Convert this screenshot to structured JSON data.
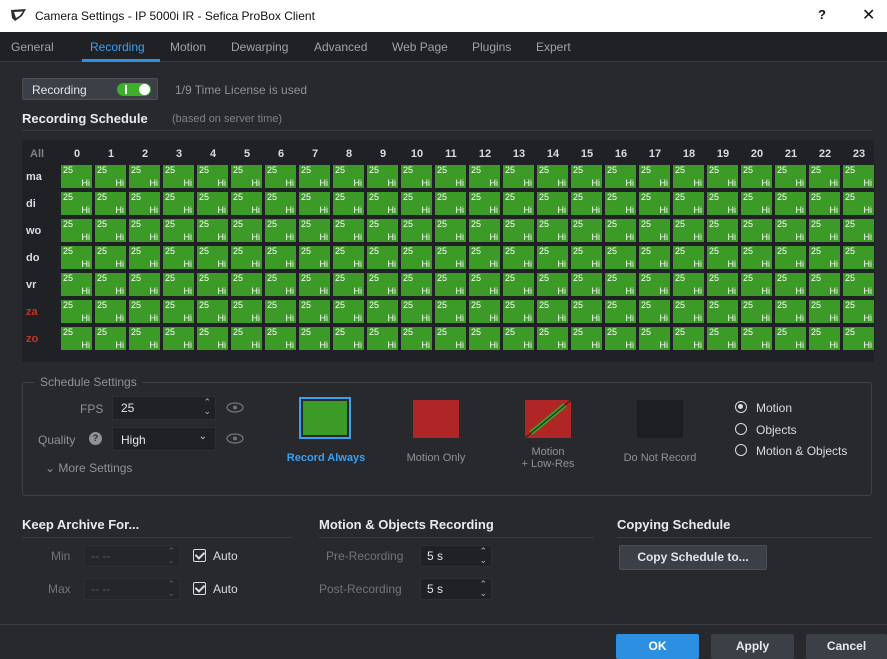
{
  "window": {
    "title": "Camera Settings - IP 5000i IR - Sefica ProBox Client",
    "help": "?",
    "close": "✕"
  },
  "tabs": [
    "General",
    "Recording",
    "Motion",
    "Dewarping",
    "Advanced",
    "Web Page",
    "Plugins",
    "Expert"
  ],
  "active_tab": "Recording",
  "recording": {
    "label": "Recording",
    "enabled": true,
    "license_text": "1/9 Time License is used"
  },
  "schedule": {
    "title": "Recording Schedule",
    "subtitle": "(based on server time)",
    "all_label": "All",
    "hours": [
      "0",
      "1",
      "2",
      "3",
      "4",
      "5",
      "6",
      "7",
      "8",
      "9",
      "10",
      "11",
      "12",
      "13",
      "14",
      "15",
      "16",
      "17",
      "18",
      "19",
      "20",
      "21",
      "22",
      "23"
    ],
    "days": [
      {
        "label": "ma",
        "weekend": false
      },
      {
        "label": "di",
        "weekend": false
      },
      {
        "label": "wo",
        "weekend": false
      },
      {
        "label": "do",
        "weekend": false
      },
      {
        "label": "vr",
        "weekend": false
      },
      {
        "label": "za",
        "weekend": true
      },
      {
        "label": "zo",
        "weekend": true
      }
    ],
    "cell_fps": "25",
    "cell_quality": "Hi",
    "cell_color": "#3c9a27"
  },
  "schedule_settings": {
    "legend": "Schedule Settings",
    "fps_label": "FPS",
    "fps_value": "25",
    "quality_label": "Quality",
    "quality_value": "High",
    "more_settings": "More Settings",
    "modes": [
      {
        "label": "Record Always",
        "color": "#3c9a27",
        "active": true
      },
      {
        "label": "Motion Only",
        "color": "#b02525",
        "active": false
      },
      {
        "label": "Motion\n+ Low-Res",
        "color": "#b02525",
        "active": false
      },
      {
        "label": "Do Not Record",
        "color": "#1c1e22",
        "active": false
      }
    ],
    "radio_options": [
      {
        "label": "Motion",
        "selected": true
      },
      {
        "label": "Objects",
        "selected": false
      },
      {
        "label": "Motion & Objects",
        "selected": false
      }
    ]
  },
  "keep_archive": {
    "title": "Keep Archive For...",
    "min_label": "Min",
    "min_value": "-- --",
    "max_label": "Max",
    "max_value": "-- --",
    "auto_label": "Auto"
  },
  "motion_recording": {
    "title": "Motion & Objects Recording",
    "pre_label": "Pre-Recording",
    "pre_value": "5 s",
    "post_label": "Post-Recording",
    "post_value": "5 s"
  },
  "copying": {
    "title": "Copying Schedule",
    "button": "Copy Schedule to..."
  },
  "footer": {
    "ok": "OK",
    "apply": "Apply",
    "cancel": "Cancel"
  }
}
